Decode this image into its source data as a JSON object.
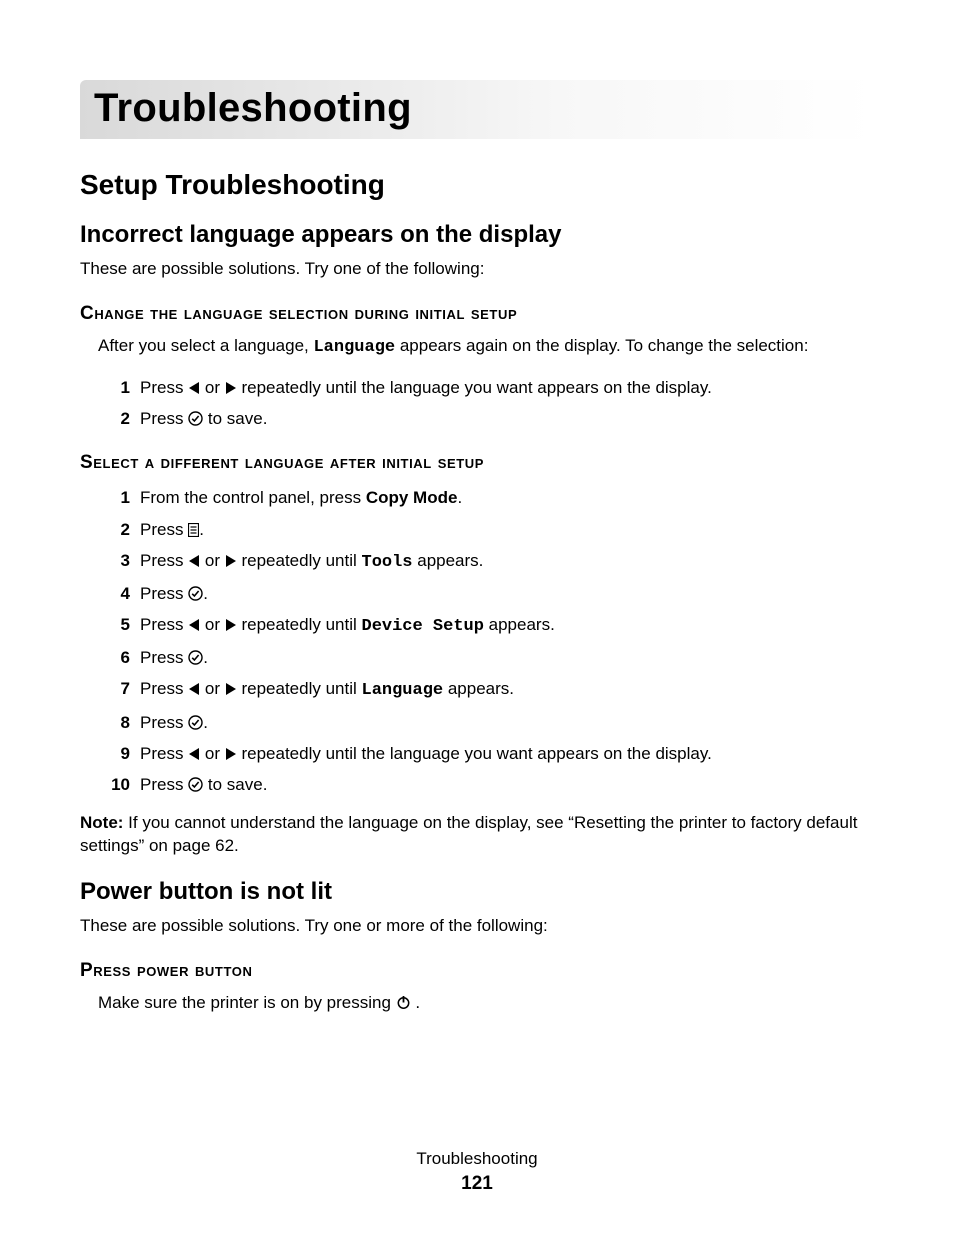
{
  "chapter_title": "Troubleshooting",
  "section_a": {
    "title": "Setup Troubleshooting",
    "sub1": {
      "title": "Incorrect language appears on the display",
      "lead": "These are possible solutions. Try one of the following:",
      "block1": {
        "heading": "Change the language selection during initial setup",
        "intro_a": "After you select a language, ",
        "intro_mono": "Language",
        "intro_b": " appears again on the display. To change the selection:",
        "steps": [
          {
            "n": "1",
            "a": "Press ",
            "b": " or ",
            "c": " repeatedly until the language you want appears on the display."
          },
          {
            "n": "2",
            "a": "Press ",
            "c": " to save."
          }
        ]
      },
      "block2": {
        "heading": "Select a different language after initial setup",
        "steps": [
          {
            "n": "1",
            "a": "From the control panel, press ",
            "bold": "Copy Mode",
            "c": "."
          },
          {
            "n": "2",
            "a": "Press ",
            "c": "."
          },
          {
            "n": "3",
            "a": "Press ",
            "b": " or ",
            "mid": " repeatedly until ",
            "mono": "Tools",
            "c": " appears."
          },
          {
            "n": "4",
            "a": "Press ",
            "c": "."
          },
          {
            "n": "5",
            "a": "Press ",
            "b": " or ",
            "mid": " repeatedly until ",
            "mono": "Device Setup",
            "c": " appears."
          },
          {
            "n": "6",
            "a": "Press ",
            "c": "."
          },
          {
            "n": "7",
            "a": "Press ",
            "b": " or ",
            "mid": " repeatedly until ",
            "mono": "Language",
            "c": " appears."
          },
          {
            "n": "8",
            "a": "Press ",
            "c": "."
          },
          {
            "n": "9",
            "a": "Press ",
            "b": " or ",
            "c": " repeatedly until the language you want appears on the display."
          },
          {
            "n": "10",
            "a": "Press ",
            "c": " to save."
          }
        ],
        "note_label": "Note:",
        "note_text": " If you cannot understand the language on the display, see “Resetting the printer to factory default settings” on page 62."
      }
    },
    "sub2": {
      "title": "Power button is not lit",
      "lead": "These are possible solutions. Try one or more of the following:",
      "block1": {
        "heading": "Press power button",
        "text_a": "Make sure the printer is on by pressing ",
        "text_b": " ."
      }
    }
  },
  "footer": {
    "title": "Troubleshooting",
    "page": "121"
  }
}
